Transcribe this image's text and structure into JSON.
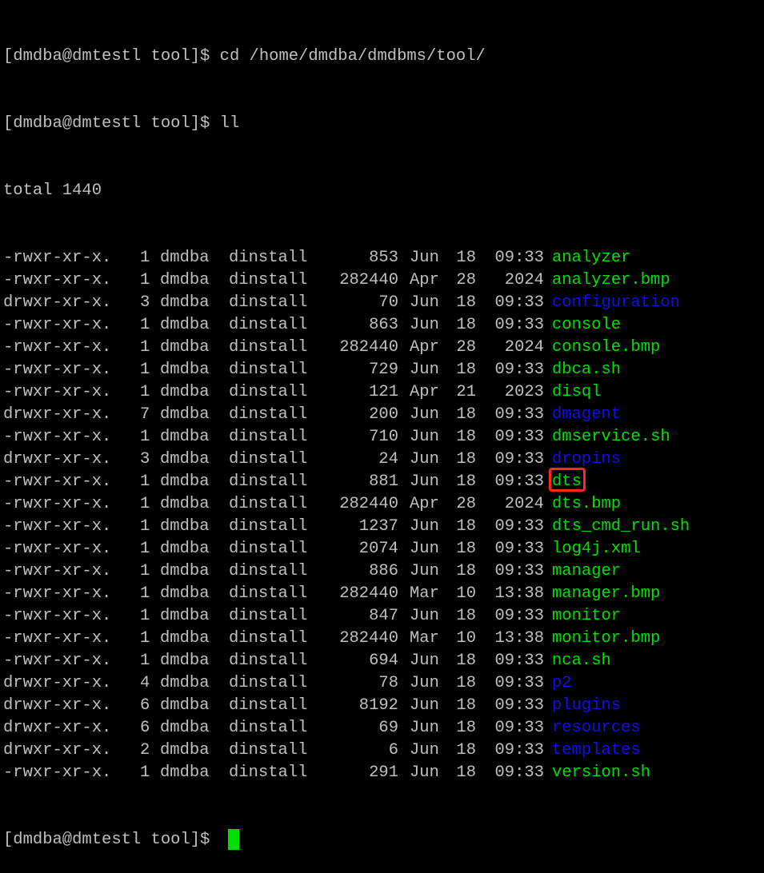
{
  "prompt": {
    "line1": "[dmdba@dmtestl tool]$ cd /home/dmdba/dmdbms/tool/",
    "line2": "[dmdba@dmtestl tool]$ ll",
    "final": "[dmdba@dmtestl tool]$ "
  },
  "total": "total 1440",
  "colors": {
    "executable": "#00e000",
    "directory": "#1010e8",
    "text": "#c0c0c0",
    "highlight": "#ff2a1a",
    "cursor": "#00e000"
  },
  "entries": [
    {
      "perm": "-rwxr-xr-x.",
      "links": "1",
      "owner": "dmdba",
      "group": "dinstall",
      "size": "853",
      "month": "Jun",
      "day": "18",
      "time": "09:33",
      "name": "analyzer",
      "type": "exec"
    },
    {
      "perm": "-rwxr-xr-x.",
      "links": "1",
      "owner": "dmdba",
      "group": "dinstall",
      "size": "282440",
      "month": "Apr",
      "day": "28",
      "time": "2024",
      "name": "analyzer.bmp",
      "type": "exec"
    },
    {
      "perm": "drwxr-xr-x.",
      "links": "3",
      "owner": "dmdba",
      "group": "dinstall",
      "size": "70",
      "month": "Jun",
      "day": "18",
      "time": "09:33",
      "name": "configuration",
      "type": "dir"
    },
    {
      "perm": "-rwxr-xr-x.",
      "links": "1",
      "owner": "dmdba",
      "group": "dinstall",
      "size": "863",
      "month": "Jun",
      "day": "18",
      "time": "09:33",
      "name": "console",
      "type": "exec"
    },
    {
      "perm": "-rwxr-xr-x.",
      "links": "1",
      "owner": "dmdba",
      "group": "dinstall",
      "size": "282440",
      "month": "Apr",
      "day": "28",
      "time": "2024",
      "name": "console.bmp",
      "type": "exec"
    },
    {
      "perm": "-rwxr-xr-x.",
      "links": "1",
      "owner": "dmdba",
      "group": "dinstall",
      "size": "729",
      "month": "Jun",
      "day": "18",
      "time": "09:33",
      "name": "dbca.sh",
      "type": "exec"
    },
    {
      "perm": "-rwxr-xr-x.",
      "links": "1",
      "owner": "dmdba",
      "group": "dinstall",
      "size": "121",
      "month": "Apr",
      "day": "21",
      "time": "2023",
      "name": "disql",
      "type": "exec"
    },
    {
      "perm": "drwxr-xr-x.",
      "links": "7",
      "owner": "dmdba",
      "group": "dinstall",
      "size": "200",
      "month": "Jun",
      "day": "18",
      "time": "09:33",
      "name": "dmagent",
      "type": "dir"
    },
    {
      "perm": "-rwxr-xr-x.",
      "links": "1",
      "owner": "dmdba",
      "group": "dinstall",
      "size": "710",
      "month": "Jun",
      "day": "18",
      "time": "09:33",
      "name": "dmservice.sh",
      "type": "exec"
    },
    {
      "perm": "drwxr-xr-x.",
      "links": "3",
      "owner": "dmdba",
      "group": "dinstall",
      "size": "24",
      "month": "Jun",
      "day": "18",
      "time": "09:33",
      "name": "dropins",
      "type": "dir"
    },
    {
      "perm": "-rwxr-xr-x.",
      "links": "1",
      "owner": "dmdba",
      "group": "dinstall",
      "size": "881",
      "month": "Jun",
      "day": "18",
      "time": "09:33",
      "name": "dts",
      "type": "exec",
      "highlighted": true
    },
    {
      "perm": "-rwxr-xr-x.",
      "links": "1",
      "owner": "dmdba",
      "group": "dinstall",
      "size": "282440",
      "month": "Apr",
      "day": "28",
      "time": "2024",
      "name": "dts.bmp",
      "type": "exec"
    },
    {
      "perm": "-rwxr-xr-x.",
      "links": "1",
      "owner": "dmdba",
      "group": "dinstall",
      "size": "1237",
      "month": "Jun",
      "day": "18",
      "time": "09:33",
      "name": "dts_cmd_run.sh",
      "type": "exec"
    },
    {
      "perm": "-rwxr-xr-x.",
      "links": "1",
      "owner": "dmdba",
      "group": "dinstall",
      "size": "2074",
      "month": "Jun",
      "day": "18",
      "time": "09:33",
      "name": "log4j.xml",
      "type": "exec"
    },
    {
      "perm": "-rwxr-xr-x.",
      "links": "1",
      "owner": "dmdba",
      "group": "dinstall",
      "size": "886",
      "month": "Jun",
      "day": "18",
      "time": "09:33",
      "name": "manager",
      "type": "exec"
    },
    {
      "perm": "-rwxr-xr-x.",
      "links": "1",
      "owner": "dmdba",
      "group": "dinstall",
      "size": "282440",
      "month": "Mar",
      "day": "10",
      "time": "13:38",
      "name": "manager.bmp",
      "type": "exec"
    },
    {
      "perm": "-rwxr-xr-x.",
      "links": "1",
      "owner": "dmdba",
      "group": "dinstall",
      "size": "847",
      "month": "Jun",
      "day": "18",
      "time": "09:33",
      "name": "monitor",
      "type": "exec"
    },
    {
      "perm": "-rwxr-xr-x.",
      "links": "1",
      "owner": "dmdba",
      "group": "dinstall",
      "size": "282440",
      "month": "Mar",
      "day": "10",
      "time": "13:38",
      "name": "monitor.bmp",
      "type": "exec"
    },
    {
      "perm": "-rwxr-xr-x.",
      "links": "1",
      "owner": "dmdba",
      "group": "dinstall",
      "size": "694",
      "month": "Jun",
      "day": "18",
      "time": "09:33",
      "name": "nca.sh",
      "type": "exec"
    },
    {
      "perm": "drwxr-xr-x.",
      "links": "4",
      "owner": "dmdba",
      "group": "dinstall",
      "size": "78",
      "month": "Jun",
      "day": "18",
      "time": "09:33",
      "name": "p2",
      "type": "dir"
    },
    {
      "perm": "drwxr-xr-x.",
      "links": "6",
      "owner": "dmdba",
      "group": "dinstall",
      "size": "8192",
      "month": "Jun",
      "day": "18",
      "time": "09:33",
      "name": "plugins",
      "type": "dir"
    },
    {
      "perm": "drwxr-xr-x.",
      "links": "6",
      "owner": "dmdba",
      "group": "dinstall",
      "size": "69",
      "month": "Jun",
      "day": "18",
      "time": "09:33",
      "name": "resources",
      "type": "dir"
    },
    {
      "perm": "drwxr-xr-x.",
      "links": "2",
      "owner": "dmdba",
      "group": "dinstall",
      "size": "6",
      "month": "Jun",
      "day": "18",
      "time": "09:33",
      "name": "templates",
      "type": "dir"
    },
    {
      "perm": "-rwxr-xr-x.",
      "links": "1",
      "owner": "dmdba",
      "group": "dinstall",
      "size": "291",
      "month": "Jun",
      "day": "18",
      "time": "09:33",
      "name": "version.sh",
      "type": "exec"
    }
  ]
}
